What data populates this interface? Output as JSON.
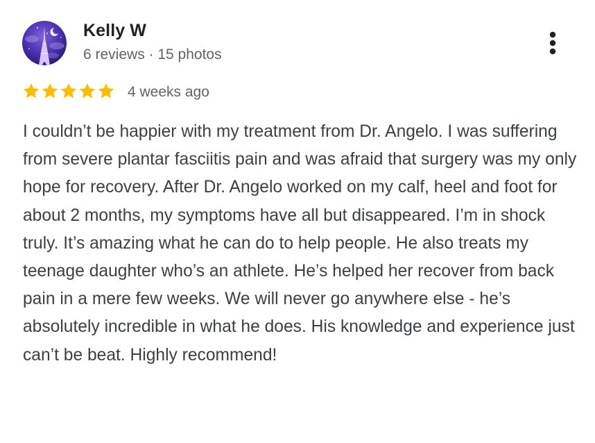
{
  "review": {
    "author": {
      "name": "Kelly W",
      "meta": "6 reviews · 15 photos",
      "avatar_icon": "night-sky-tower-avatar"
    },
    "rating": {
      "stars": 5,
      "max": 5,
      "color": "#fbbc04"
    },
    "date": "4 weeks ago",
    "text": "I couldn’t be happier with my treatment from Dr. Angelo. I was suffering from severe plantar fasciitis pain and was afraid that surgery was my only hope for recovery. After Dr. Angelo worked on my calf, heel and foot for about 2 months, my symptoms have all but disappeared. I’m in shock truly. It’s amazing what he can do to help people. He also treats my teenage daughter who’s an athlete. He’s helped her recover from back pain in a mere few weeks. We will never go anywhere else - he’s absolutely incredible in what he does. His knowledge and experience just can’t be beat. Highly recommend!",
    "more_icon": "more-vert-icon"
  }
}
